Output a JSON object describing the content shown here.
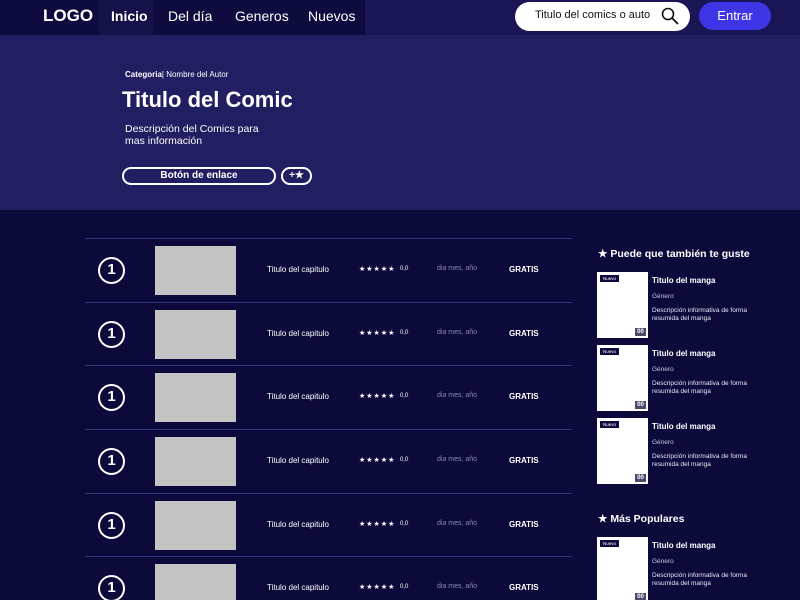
{
  "nav": {
    "logo": "LOGO",
    "links": [
      "Inicio",
      "Del día",
      "Generos",
      "Nuevos"
    ],
    "search_placeholder": "Titulo del comics o autor",
    "enter_label": "Entrar"
  },
  "hero": {
    "category": "Categoria",
    "author": "| Nombre del Autor",
    "title": "Titulo del Comic",
    "description": "Descripción del Comics para mas información",
    "link_button": "Botón de enlace",
    "fav_button": "+★"
  },
  "chapters": [
    {
      "number": "1",
      "title": "Titulo del capitulo",
      "stars": "★★★★★",
      "rating": "0,0",
      "date": "dia mes, año",
      "price": "GRATIS"
    },
    {
      "number": "1",
      "title": "Titulo del capitulo",
      "stars": "★★★★★",
      "rating": "0,0",
      "date": "dia mes, año",
      "price": "GRATIS"
    },
    {
      "number": "1",
      "title": "Titulo del capitulo",
      "stars": "★★★★★",
      "rating": "0,0",
      "date": "dia mes, año",
      "price": "GRATIS"
    },
    {
      "number": "1",
      "title": "Titulo del capitulo",
      "stars": "★★★★★",
      "rating": "0,0",
      "date": "dia mes, año",
      "price": "GRATIS"
    },
    {
      "number": "1",
      "title": "Titulo del capitulo",
      "stars": "★★★★★",
      "rating": "0,0",
      "date": "dia mes, año",
      "price": "GRATIS"
    },
    {
      "number": "1",
      "title": "Titulo del capitulo",
      "stars": "★★★★★",
      "rating": "0,0",
      "date": "dia mes, año",
      "price": "GRATIS"
    }
  ],
  "sidebar": {
    "recommended_heading": "★ Puede que también te guste",
    "popular_heading": "★ Más Populares",
    "recommended": [
      {
        "badge": "Nuevo",
        "title": "Titulo del manga",
        "genre": "Género",
        "description": "Descripción informativa de forma resumida del manga",
        "icon": "00"
      },
      {
        "badge": "Nuevo",
        "title": "Titulo del manga",
        "genre": "Género",
        "description": "Descripción informativa de forma resumida del manga",
        "icon": "00"
      },
      {
        "badge": "Nuevo",
        "title": "Titulo del manga",
        "genre": "Género",
        "description": "Descripción informativa de forma resumida del manga",
        "icon": "00"
      }
    ],
    "popular": [
      {
        "badge": "Nuevo",
        "title": "Titulo del manga",
        "genre": "Género",
        "description": "Descripción informativa de forma resumida del manga",
        "icon": "00"
      }
    ]
  },
  "colors": {
    "background": "#0c0a3a",
    "nav": "#1a1656",
    "hero": "#211e62",
    "accent": "#3d35e6",
    "thumbnail": "#c4c4c4"
  }
}
